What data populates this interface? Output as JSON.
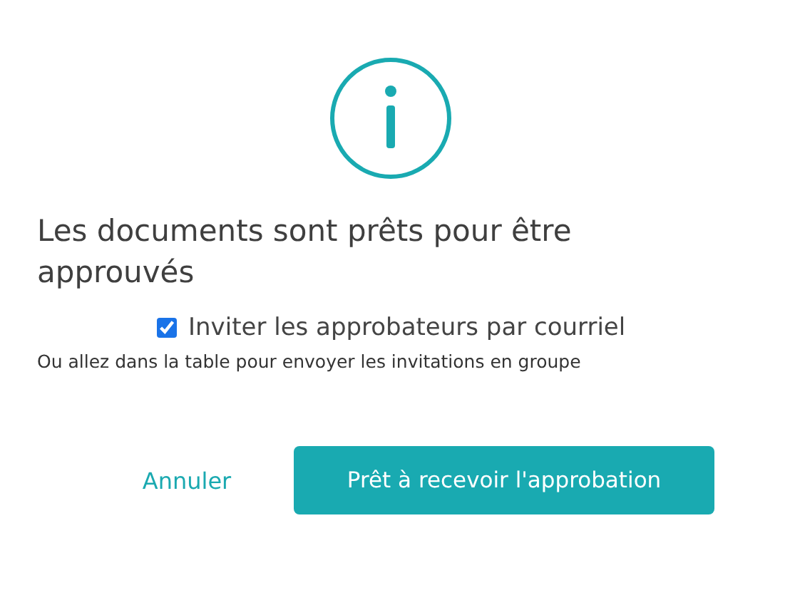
{
  "title": "Les documents sont prêts pour être approuvés",
  "invite": {
    "label": "Inviter les approbateurs par courriel",
    "checked": true
  },
  "hint": "Ou allez dans la table pour envoyer les invitations en groupe",
  "buttons": {
    "cancel": "Annuler",
    "confirm": "Prêt à recevoir l'approbation"
  }
}
